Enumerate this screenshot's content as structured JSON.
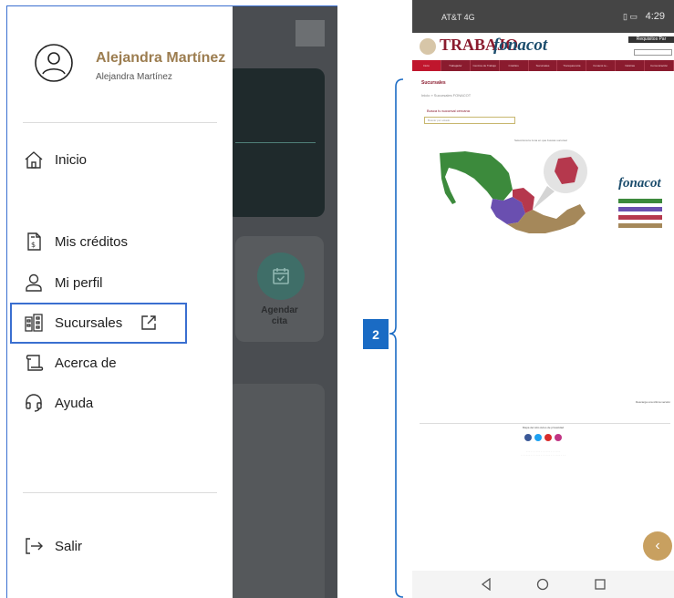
{
  "left_phone": {
    "profile": {
      "name": "Alejandra Martínez",
      "subtitle": "Alejandra Martínez"
    },
    "menu": {
      "inicio": "Inicio",
      "mis_creditos": "Mis créditos",
      "mi_perfil": "Mi perfil",
      "sucursales": "Sucursales",
      "acerca_de": "Acerca de",
      "ayuda": "Ayuda",
      "salir": "Salir"
    },
    "background_tile": {
      "label": "Agendar\ncita"
    }
  },
  "callout": {
    "number": "2"
  },
  "right_phone": {
    "status_bar": {
      "carrier": "AT&T 4G",
      "time": "4:29"
    },
    "header": {
      "brand_left": "TRABAJO",
      "brand_right": "fonacot",
      "top_button": "Requisitos Par"
    },
    "nav_items": [
      "Inicio",
      "Trabajador",
      "Centros de Trabajo",
      "Créditos",
      "Sucursales",
      "Transparencia",
      "Fonacot te...",
      "Noticias",
      "Comunicación"
    ],
    "page": {
      "title": "Sucursales",
      "breadcrumb": "Inicio » Sucursales FONACOT",
      "search_label": "Busca tu sucursal cercana",
      "search_placeholder": "Buscar por estado",
      "map_hint": "Selecciona la zona en que buscas sucursal",
      "side_brand": "fonacot",
      "footer_right": "Descarga una última versión",
      "links": "Mapa del sitio    Aviso de privacidad"
    },
    "legend_colors": [
      "#3c8a3c",
      "#6a4fb0",
      "#b5384d",
      "#a5885a"
    ],
    "fab_icon": "chevron-left-icon"
  }
}
